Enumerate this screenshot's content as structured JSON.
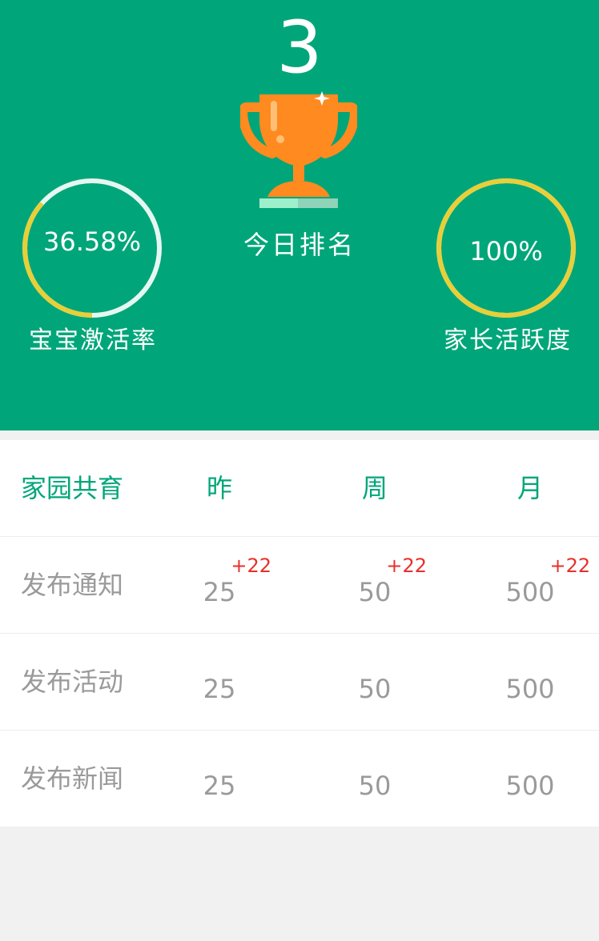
{
  "hero": {
    "rank": "3",
    "rank_label": "今日排名",
    "left_ring": {
      "value": "36.58%",
      "caption": "宝宝激活率",
      "fraction": 0.3658,
      "track_color": "#e6f7f2",
      "fill_color": "#e8cf3a"
    },
    "right_ring": {
      "value": "100%",
      "caption": "家长活跃度",
      "fraction": 1.0,
      "track_color": "#e6f7f2",
      "fill_color": "#e8cf3a"
    },
    "icon": "trophy-icon"
  },
  "colors": {
    "brand": "#00a679",
    "trophy": "#ff8a1f",
    "delta": "#e8302a",
    "muted_text": "#9a9a9a"
  },
  "table": {
    "headers": [
      "家园共育",
      "昨",
      "周",
      "月"
    ],
    "rows": [
      {
        "label": "发布通知",
        "day": "25",
        "day_delta": "+22",
        "week": "50",
        "week_delta": "+22",
        "month": "500",
        "month_delta": "+22"
      },
      {
        "label": "发布活动",
        "day": "25",
        "day_delta": "",
        "week": "50",
        "week_delta": "",
        "month": "500",
        "month_delta": ""
      },
      {
        "label": "发布新闻",
        "day": "25",
        "day_delta": "",
        "week": "50",
        "week_delta": "",
        "month": "500",
        "month_delta": ""
      }
    ]
  }
}
